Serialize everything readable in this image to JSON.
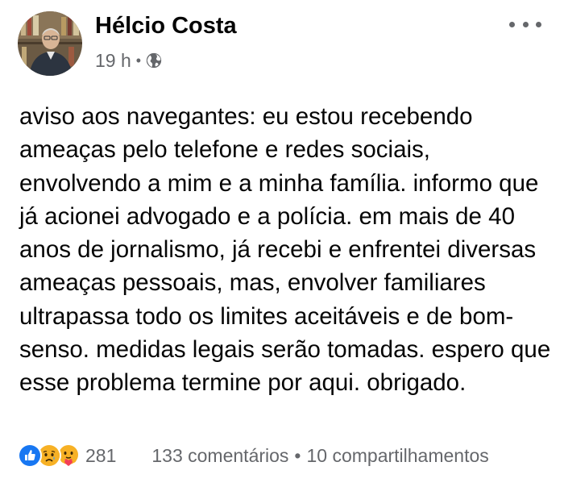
{
  "post": {
    "author": "Hélcio Costa",
    "time": "19 h",
    "separator": "•",
    "audience_icon": "globe-icon",
    "text": "aviso aos navegantes: eu estou recebendo ameaças pelo telefone e redes sociais, envolvendo a mim e a minha família. informo que já acionei advogado e a polícia. em mais de 40 anos de jornalismo, já recebi e enfrentei diversas ameaças pessoais, mas, envolver familiares ultrapassa todo os limites aceitáveis e de bom-senso. medidas legais serão tomadas. espero que esse problema termine por aqui. obrigado."
  },
  "reactions": {
    "icons": [
      "like-icon",
      "sad-icon",
      "care-icon"
    ],
    "count": "281",
    "comments": "133 comentários",
    "separator": "•",
    "shares": "10 compartilhamentos"
  },
  "colors": {
    "text": "#050505",
    "secondary": "#65676b",
    "like_blue": "#1877f2",
    "reaction_yellow": "#f7b125"
  }
}
